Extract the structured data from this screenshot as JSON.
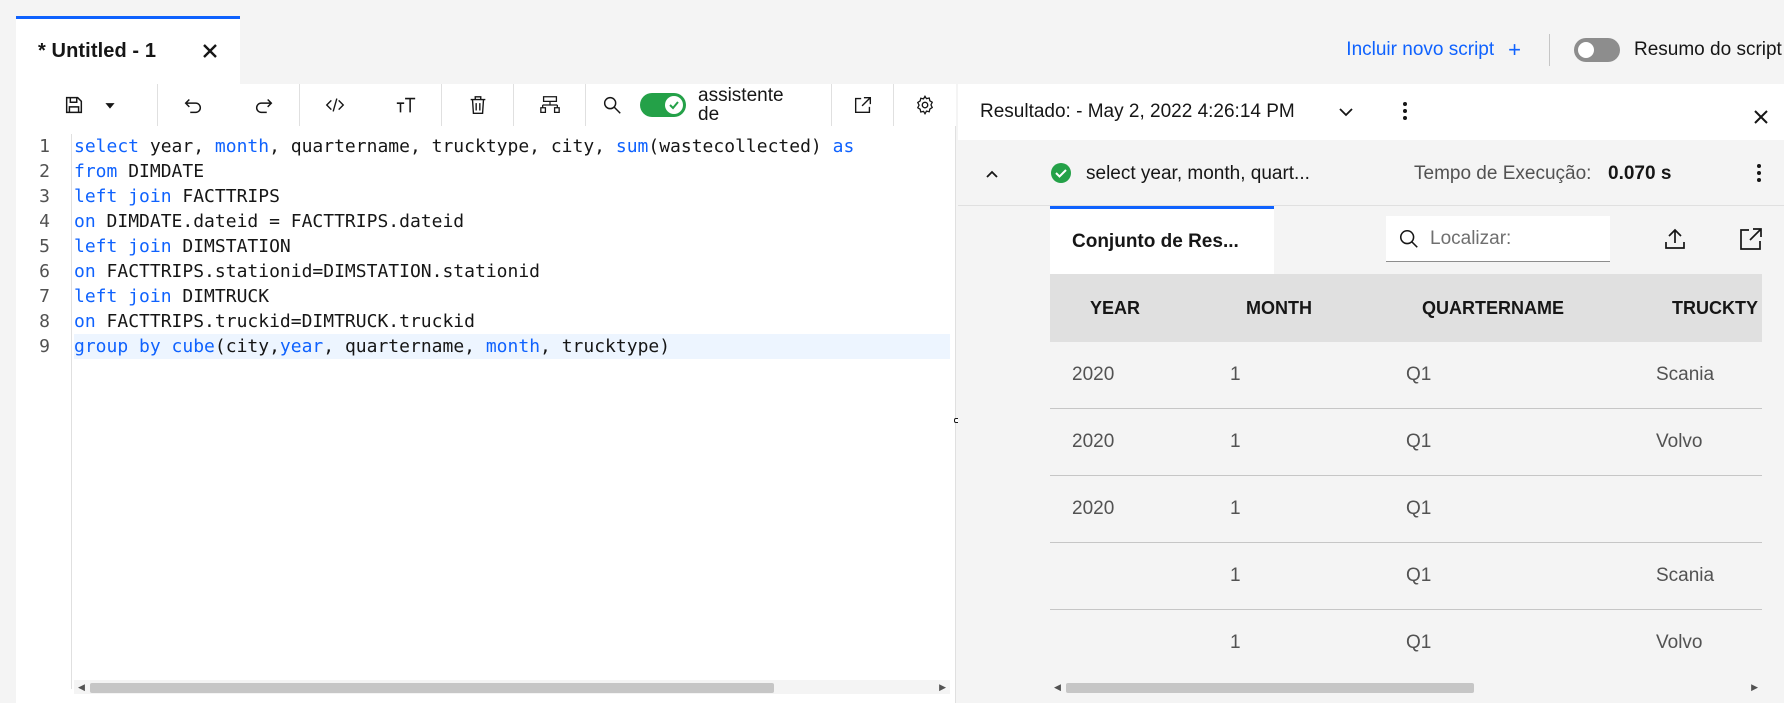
{
  "tab": {
    "title": "* Untitled - 1",
    "close_icon": "close-icon"
  },
  "header": {
    "add_script_label": "Incluir novo script",
    "add_script_icon": "+",
    "summary_label": "Resumo do script"
  },
  "toolbar": {
    "assistant_label": "assistente de conteúdo",
    "assistant_on": true
  },
  "editor": {
    "line_numbers": [
      "1",
      "2",
      "3",
      "4",
      "5",
      "6",
      "7",
      "8",
      "9"
    ],
    "lines": [
      [
        {
          "t": "select",
          "k": 1
        },
        {
          "t": " year, "
        },
        {
          "t": "month",
          "k": 1
        },
        {
          "t": ", quartername, trucktype, city, "
        },
        {
          "t": "sum",
          "k": 1
        },
        {
          "t": "(wastecollected) "
        },
        {
          "t": "as",
          "k": 1
        }
      ],
      [
        {
          "t": "from",
          "k": 1
        },
        {
          "t": " DIMDATE"
        }
      ],
      [
        {
          "t": "left join",
          "k": 1
        },
        {
          "t": " FACTTRIPS"
        }
      ],
      [
        {
          "t": "on",
          "k": 1
        },
        {
          "t": " DIMDATE.dateid = FACTTRIPS.dateid"
        }
      ],
      [
        {
          "t": "left join",
          "k": 1
        },
        {
          "t": " DIMSTATION"
        }
      ],
      [
        {
          "t": "on",
          "k": 1
        },
        {
          "t": " FACTTRIPS.stationid=DIMSTATION.stationid"
        }
      ],
      [
        {
          "t": "left join",
          "k": 1
        },
        {
          "t": " DIMTRUCK"
        }
      ],
      [
        {
          "t": "on",
          "k": 1
        },
        {
          "t": " FACTTRIPS.truckid=DIMTRUCK.truckid"
        }
      ],
      [
        {
          "t": "group by cube",
          "k": 1
        },
        {
          "t": "(city,"
        },
        {
          "t": "year",
          "k": 1
        },
        {
          "t": ", quartername, "
        },
        {
          "t": "month",
          "k": 1
        },
        {
          "t": ", trucktype)"
        }
      ]
    ],
    "active_line": 8,
    "keyword_color": "#0f62fe"
  },
  "results": {
    "title": "Resultado: - May 2, 2022 4:26:14 PM",
    "query_preview": "select year, month, quart...",
    "exec_label": "Tempo de Execução:",
    "exec_value": "0.070 s",
    "status": "success",
    "result_tab_label": "Conjunto de Res...",
    "search_placeholder": "Localizar:",
    "columns": [
      "YEAR",
      "MONTH",
      "QUARTERNAME",
      "TRUCKTY"
    ],
    "rows": [
      [
        "2020",
        "1",
        "Q1",
        "Scania"
      ],
      [
        "2020",
        "1",
        "Q1",
        "Volvo"
      ],
      [
        "2020",
        "1",
        "Q1",
        ""
      ],
      [
        "",
        "1",
        "Q1",
        "Scania"
      ],
      [
        "",
        "1",
        "Q1",
        "Volvo"
      ]
    ]
  },
  "colors": {
    "accent": "#0f62fe",
    "success": "#24a148"
  }
}
